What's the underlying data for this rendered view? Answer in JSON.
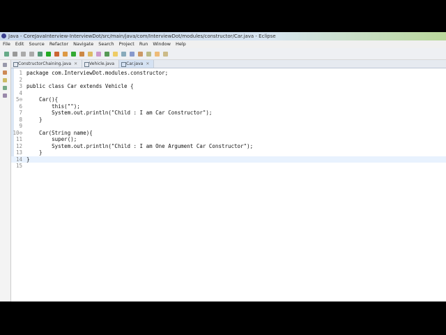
{
  "window_title": "Java - CoreJavaInterview-InterviewDot/src/main/java/com/InterviewDot/modules/constructor/Car.java - Eclipse",
  "menu": [
    "File",
    "Edit",
    "Source",
    "Refactor",
    "Navigate",
    "Search",
    "Project",
    "Run",
    "Window",
    "Help"
  ],
  "tabs": [
    {
      "label": "ConstructorChaining.java",
      "close": "✕"
    },
    {
      "label": "Vehicle.java",
      "close": ""
    },
    {
      "label": "Car.java",
      "close": "✕"
    }
  ],
  "code": [
    {
      "n": "1",
      "t": "package com.InterviewDot.modules.constructor;"
    },
    {
      "n": "2",
      "t": ""
    },
    {
      "n": "3",
      "t": "public class Car extends Vehicle {"
    },
    {
      "n": "4",
      "t": ""
    },
    {
      "n": "5⊖",
      "t": "    Car(){"
    },
    {
      "n": "6",
      "t": "        this(\"\");"
    },
    {
      "n": "7",
      "t": "        System.out.println(\"Child : I am Car Constructor\");"
    },
    {
      "n": "8",
      "t": "    }"
    },
    {
      "n": "9",
      "t": ""
    },
    {
      "n": "10⊖",
      "t": "    Car(String name){"
    },
    {
      "n": "11",
      "t": "        super();"
    },
    {
      "n": "12",
      "t": "        System.out.println(\"Child : I am One Argument Car Constructor\");"
    },
    {
      "n": "13",
      "t": "    }"
    },
    {
      "n": "14",
      "t": "}"
    },
    {
      "n": "15",
      "t": ""
    }
  ]
}
